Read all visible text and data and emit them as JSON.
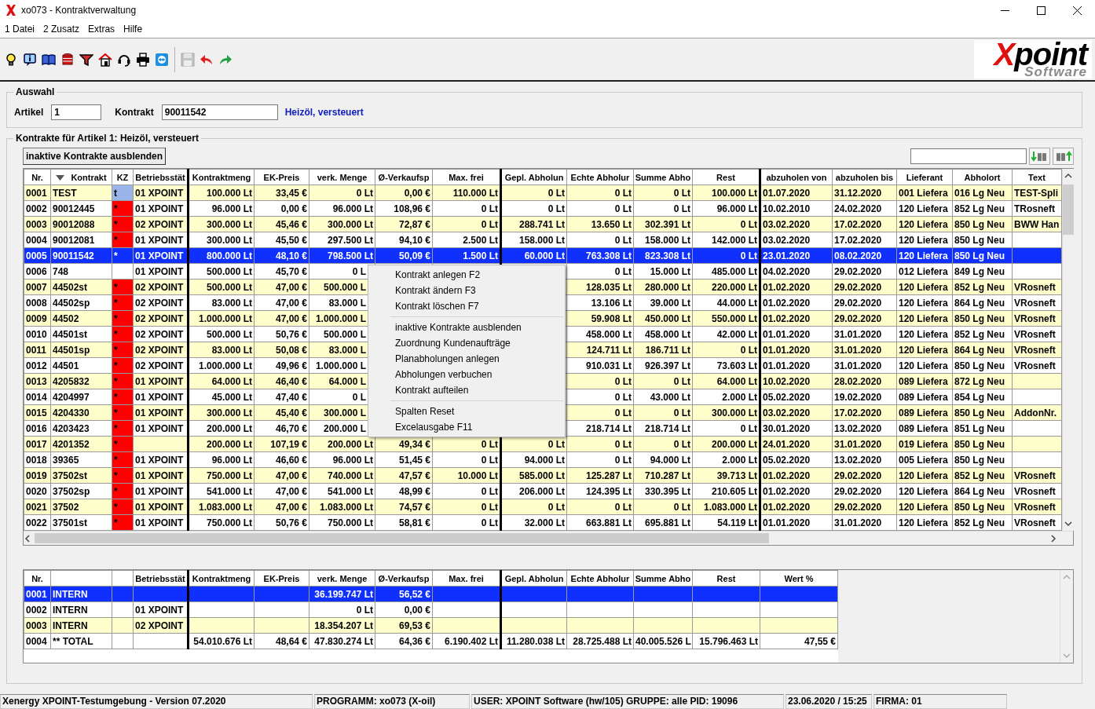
{
  "window": {
    "title": "xo073 - Kontraktverwaltung"
  },
  "menu_bar": [
    "1 Datei",
    "2 Zusatz",
    "Extras",
    "Hilfe"
  ],
  "toolbar": [
    {
      "kind": "bulb",
      "disabled": false
    },
    {
      "kind": "info",
      "disabled": false
    },
    {
      "kind": "book",
      "disabled": false
    },
    {
      "kind": "coins",
      "disabled": false
    },
    {
      "kind": "filter",
      "disabled": false
    },
    {
      "kind": "house",
      "disabled": false
    },
    {
      "kind": "headset",
      "disabled": false
    },
    {
      "kind": "printer",
      "disabled": false
    },
    {
      "kind": "remote",
      "disabled": false
    },
    {
      "kind": "separator"
    },
    {
      "kind": "save",
      "disabled": true
    },
    {
      "kind": "undo",
      "disabled": false
    },
    {
      "kind": "redo",
      "disabled": false
    }
  ],
  "logo": {
    "mark": "X",
    "name": "point",
    "tagline": "Software"
  },
  "selection": {
    "title": "Auswahl",
    "article_label": "Artikel",
    "article_value": "1",
    "contract_label": "Kontrakt",
    "contract_value": "90011542",
    "article_name": "Heizöl, versteuert"
  },
  "contracts": {
    "title": "Kontrakte für Artikel 1: Heizöl, versteuert",
    "hide_button": "inaktive Kontrakte ausblenden"
  },
  "table": {
    "columns": [
      {
        "label": "Nr.",
        "sorted": false
      },
      {
        "label": "Kontrakt",
        "sorted": true
      },
      {
        "label": "KZ",
        "sorted": false
      },
      {
        "label": "Betriebsstät",
        "sorted": false
      },
      {
        "label": "Kontraktmeng",
        "sorted": false
      },
      {
        "label": "EK-Preis",
        "sorted": false
      },
      {
        "label": "verk. Menge",
        "sorted": false
      },
      {
        "label": "Ø-Verkaufsp",
        "sorted": false
      },
      {
        "label": "Max. frei",
        "sorted": false
      },
      {
        "label": "Gepl. Abholun",
        "sorted": false
      },
      {
        "label": "Echte Abholur",
        "sorted": false
      },
      {
        "label": "Summe Abho",
        "sorted": false
      },
      {
        "label": "Rest",
        "sorted": false
      },
      {
        "label": "abzuholen von",
        "sorted": false
      },
      {
        "label": "abzuholen bis",
        "sorted": false
      },
      {
        "label": "Lieferant",
        "sorted": false
      },
      {
        "label": "Abholort",
        "sorted": false
      },
      {
        "label": "Text",
        "sorted": false
      }
    ],
    "rows": [
      {
        "selected": false,
        "color": "#99b4e8",
        "cells": [
          "0001",
          "TEST",
          "t",
          "01 XPOINT",
          "100.000 Lt",
          "33,45 €",
          "0 Lt",
          "0,00 €",
          "110.000 Lt",
          "0 Lt",
          "0 Lt",
          "0 Lt",
          "100.000 Lt",
          "01.07.2020",
          "31.12.2020",
          "001 Liefera",
          "016 Lg Neu",
          "TEST-Spli"
        ]
      },
      {
        "selected": false,
        "color": "#ff0000",
        "cells": [
          "0002",
          "90012445",
          "*",
          "01 XPOINT",
          "96.000 Lt",
          "0,00 €",
          "96.000 Lt",
          "108,96 €",
          "0 Lt",
          "0 Lt",
          "0 Lt",
          "0 Lt",
          "96.000 Lt",
          "10.02.2010",
          "24.02.2020",
          "120 Liefera",
          "852 Lg Neu",
          "TRosneft"
        ]
      },
      {
        "selected": false,
        "color": "#ff0000",
        "cells": [
          "0003",
          "90012088",
          "*",
          "02 XPOINT",
          "300.000 Lt",
          "45,46 €",
          "300.000 Lt",
          "72,87 €",
          "0 Lt",
          "288.741 Lt",
          "13.650 Lt",
          "302.391 Lt",
          "0 Lt",
          "03.02.2020",
          "17.02.2020",
          "120 Liefera",
          "850 Lg Neu",
          "BWW Han"
        ]
      },
      {
        "selected": false,
        "color": "#ff0000",
        "cells": [
          "0004",
          "90012081",
          "*",
          "01 XPOINT",
          "300.000 Lt",
          "45,50 €",
          "297.500 Lt",
          "94,10 €",
          "2.500 Lt",
          "158.000 Lt",
          "0 Lt",
          "158.000 Lt",
          "142.000 Lt",
          "03.02.2020",
          "17.02.2020",
          "120 Liefera",
          "850 Lg Neu",
          null
        ]
      },
      {
        "selected": true,
        "cells": [
          "0005",
          "90011542",
          "*",
          "01 XPOINT",
          "800.000 Lt",
          "48,10 €",
          "798.500 Lt",
          "50,09 €",
          "1.500 Lt",
          "60.000 Lt",
          "763.308 Lt",
          "823.308 Lt",
          "0 Lt",
          "23.01.2020",
          "08.02.2020",
          "120 Liefera",
          "850 Lg Neu",
          null
        ]
      },
      {
        "selected": false,
        "cells": [
          "0006",
          "748",
          null,
          "01 XPOINT",
          "500.000 Lt",
          "45,70 €",
          "0 L",
          null,
          null,
          null,
          "0 Lt",
          "15.000 Lt",
          "485.000 Lt",
          "04.02.2020",
          "29.02.2020",
          "012 Liefera",
          "849 Lg Neu",
          null
        ]
      },
      {
        "selected": false,
        "color": "#ff0000",
        "cells": [
          "0007",
          "44502st",
          "*",
          "02 XPOINT",
          "500.000 Lt",
          "47,00 €",
          "500.000 L",
          null,
          null,
          null,
          "128.035 Lt",
          "280.000 Lt",
          "220.000 Lt",
          "01.02.2020",
          "29.02.2020",
          "120 Liefera",
          "852 Lg Neu",
          "VRosneft"
        ]
      },
      {
        "selected": false,
        "color": "#ff0000",
        "cells": [
          "0008",
          "44502sp",
          "*",
          "02 XPOINT",
          "83.000 Lt",
          "47,00 €",
          "83.000 L",
          null,
          null,
          null,
          "13.106 Lt",
          "39.000 Lt",
          "44.000 Lt",
          "01.02.2020",
          "29.02.2020",
          "120 Liefera",
          "864 Lg Neu",
          "VRosneft"
        ]
      },
      {
        "selected": false,
        "color": "#ff0000",
        "cells": [
          "0009",
          "44502",
          "*",
          "02 XPOINT",
          "1.000.000 Lt",
          "47,00 €",
          "1.000.000 L",
          null,
          null,
          null,
          "59.908 Lt",
          "450.000 Lt",
          "550.000 Lt",
          "01.02.2020",
          "29.02.2020",
          "120 Liefera",
          "850 Lg Neu",
          "VRosneft"
        ]
      },
      {
        "selected": false,
        "color": "#ff0000",
        "cells": [
          "0010",
          "44501st",
          "*",
          "02 XPOINT",
          "500.000 Lt",
          "50,76 €",
          "500.000 L",
          null,
          null,
          null,
          "458.000 Lt",
          "458.000 Lt",
          "42.000 Lt",
          "01.01.2020",
          "31.01.2020",
          "120 Liefera",
          "852 Lg Neu",
          "VRosneft"
        ]
      },
      {
        "selected": false,
        "color": "#ff0000",
        "cells": [
          "0011",
          "44501sp",
          "*",
          "02 XPOINT",
          "83.000 Lt",
          "50,08 €",
          "83.000 L",
          null,
          null,
          null,
          "124.711 Lt",
          "186.711 Lt",
          "0 Lt",
          "01.01.2020",
          "31.01.2020",
          "120 Liefera",
          "864 Lg Neu",
          "VRosneft"
        ]
      },
      {
        "selected": false,
        "color": "#ff0000",
        "cells": [
          "0012",
          "44501",
          "*",
          "02 XPOINT",
          "1.000.000 Lt",
          "49,96 €",
          "1.000.000 L",
          null,
          null,
          null,
          "910.031 Lt",
          "926.397 Lt",
          "73.603 Lt",
          "01.01.2020",
          "31.01.2020",
          "120 Liefera",
          "850 Lg Neu",
          "VRosneft"
        ]
      },
      {
        "selected": false,
        "color": "#ff0000",
        "cells": [
          "0013",
          "4205832",
          "*",
          "01 XPOINT",
          "64.000 Lt",
          "46,40 €",
          "64.000 L",
          null,
          null,
          null,
          "0 Lt",
          "0 Lt",
          "64.000 Lt",
          "10.02.2020",
          "28.02.2020",
          "089 Liefera",
          "872 Lg Neu",
          null
        ]
      },
      {
        "selected": false,
        "color": "#ff0000",
        "cells": [
          "0014",
          "4204997",
          "*",
          "01 XPOINT",
          "45.000 Lt",
          "47,40 €",
          "0 L",
          null,
          null,
          null,
          "0 Lt",
          "43.000 Lt",
          "2.000 Lt",
          "05.02.2020",
          "19.02.2020",
          "089 Liefera",
          "854 Lg Neu",
          null
        ]
      },
      {
        "selected": false,
        "color": "#ff0000",
        "cells": [
          "0015",
          "4204330",
          "*",
          "01 XPOINT",
          "300.000 Lt",
          "45,40 €",
          "300.000 L",
          null,
          null,
          null,
          "0 Lt",
          "0 Lt",
          "300.000 Lt",
          "03.02.2020",
          "17.02.2020",
          "089 Liefera",
          "850 Lg Neu",
          "AddonNr."
        ]
      },
      {
        "selected": false,
        "color": "#ff0000",
        "cells": [
          "0016",
          "4203423",
          "*",
          "01 XPOINT",
          "200.000 Lt",
          "46,70 €",
          "200.000 L",
          null,
          null,
          null,
          "218.714 Lt",
          "218.714 Lt",
          "0 Lt",
          "30.01.2020",
          "13.02.2020",
          "089 Liefera",
          "851 Lg Neu",
          null
        ]
      },
      {
        "selected": false,
        "color": "#ff0000",
        "cells": [
          "0017",
          "4201352",
          "*",
          null,
          "200.000 Lt",
          "107,19 €",
          "200.000 Lt",
          "49,34 €",
          "0 Lt",
          "0 Lt",
          "0 Lt",
          "0 Lt",
          "200.000 Lt",
          "24.01.2020",
          "31.01.2020",
          "019 Liefera",
          "850 Lg Neu",
          null
        ]
      },
      {
        "selected": false,
        "color": "#ff0000",
        "cells": [
          "0018",
          "39365",
          "*",
          "01 XPOINT",
          "96.000 Lt",
          "46,60 €",
          "96.000 Lt",
          "51,45 €",
          "0 Lt",
          "94.000 Lt",
          "0 Lt",
          "94.000 Lt",
          "2.000 Lt",
          "05.02.2020",
          "13.02.2020",
          "005 Liefera",
          "850 Lg Neu",
          null
        ]
      },
      {
        "selected": false,
        "color": "#ff0000",
        "cells": [
          "0019",
          "37502st",
          "*",
          "01 XPOINT",
          "750.000 Lt",
          "47,00 €",
          "740.000 Lt",
          "47,57 €",
          "10.000 Lt",
          "585.000 Lt",
          "125.287 Lt",
          "710.287 Lt",
          "39.713 Lt",
          "01.02.2020",
          "29.02.2020",
          "120 Liefera",
          "852 Lg Neu",
          "VRosneft"
        ]
      },
      {
        "selected": false,
        "color": "#ff0000",
        "cells": [
          "0020",
          "37502sp",
          "*",
          "01 XPOINT",
          "541.000 Lt",
          "47,00 €",
          "541.000 Lt",
          "48,99 €",
          "0 Lt",
          "206.000 Lt",
          "124.395 Lt",
          "330.395 Lt",
          "210.605 Lt",
          "01.02.2020",
          "29.02.2020",
          "120 Liefera",
          "864 Lg Neu",
          "VRosneft"
        ]
      },
      {
        "selected": false,
        "color": "#ff0000",
        "cells": [
          "0021",
          "37502",
          "*",
          "01 XPOINT",
          "1.083.000 Lt",
          "47,00 €",
          "1.083.000 Lt",
          "74,57 €",
          "0 Lt",
          "0 Lt",
          "0 Lt",
          "0 Lt",
          "1.083.000 Lt",
          "01.02.2020",
          "29.02.2020",
          "120 Liefera",
          "850 Lg Neu",
          "VRosneft"
        ]
      },
      {
        "selected": false,
        "color": "#ff0000",
        "cells": [
          "0022",
          "37501st",
          "*",
          "01 XPOINT",
          "750.000 Lt",
          "50,76 €",
          "750.000 Lt",
          "58,81 €",
          "0 Lt",
          "32.000 Lt",
          "663.881 Lt",
          "695.881 Lt",
          "54.119 Lt",
          "01.01.2020",
          "31.01.2020",
          "120 Liefera",
          "852 Lg Neu",
          "VRosneft"
        ]
      }
    ]
  },
  "context_menu": {
    "groups": [
      [
        "Kontrakt anlegen F2",
        "Kontrakt ändern F3",
        "Kontrakt löschen F7"
      ],
      [
        "inaktive Kontrakte ausblenden",
        "Zuordnung Kundenaufträge",
        "Planabholungen anlegen",
        "Abholungen verbuchen",
        "Kontrakt aufteilen"
      ],
      [
        "Spalten Reset",
        "Excelausgabe F11"
      ]
    ]
  },
  "summary_table": {
    "columns": [
      "Nr.",
      null,
      null,
      "Betriebsstät",
      "Kontraktmeng",
      "EK-Preis",
      "verk. Menge",
      "Ø-Verkaufsp",
      "Max. frei",
      "Gepl. Abholun",
      "Echte Abholur",
      "Summe Abho",
      "Rest",
      "Wert %"
    ],
    "rows": [
      {
        "selected": true,
        "cells": [
          "0001",
          "INTERN",
          null,
          null,
          null,
          null,
          "36.199.747 Lt",
          "56,52 €",
          null,
          null,
          null,
          null,
          null,
          null
        ]
      },
      {
        "selected": false,
        "cells": [
          "0002",
          "INTERN",
          null,
          "01 XPOINT",
          null,
          null,
          "0 Lt",
          "0,00 €",
          null,
          null,
          null,
          null,
          null,
          null
        ]
      },
      {
        "selected": false,
        "cells": [
          "0003",
          "INTERN",
          null,
          "02 XPOINT",
          null,
          null,
          "18.354.207 Lt",
          "69,53 €",
          null,
          null,
          null,
          null,
          null,
          null
        ]
      },
      {
        "selected": false,
        "cells": [
          "0004",
          "** TOTAL",
          null,
          null,
          "54.010.676 Lt",
          "48,64 €",
          "47.830.274 Lt",
          "64,36 €",
          "6.190.402 Lt",
          "11.280.038 Lt",
          "28.725.488 Lt",
          "40.005.526 L",
          "15.796.463 Lt",
          "47,55 €"
        ]
      }
    ]
  },
  "status_bar": [
    "Xenergy XPOINT-Testumgebung - Version 07.2020",
    "PROGRAMM: xo073 (X-oil)",
    "USER: XPOINT Software (hw/105)  GRUPPE: alle  PID: 19096",
    "23.06.2020 / 15:25",
    "FIRMA: 01"
  ]
}
